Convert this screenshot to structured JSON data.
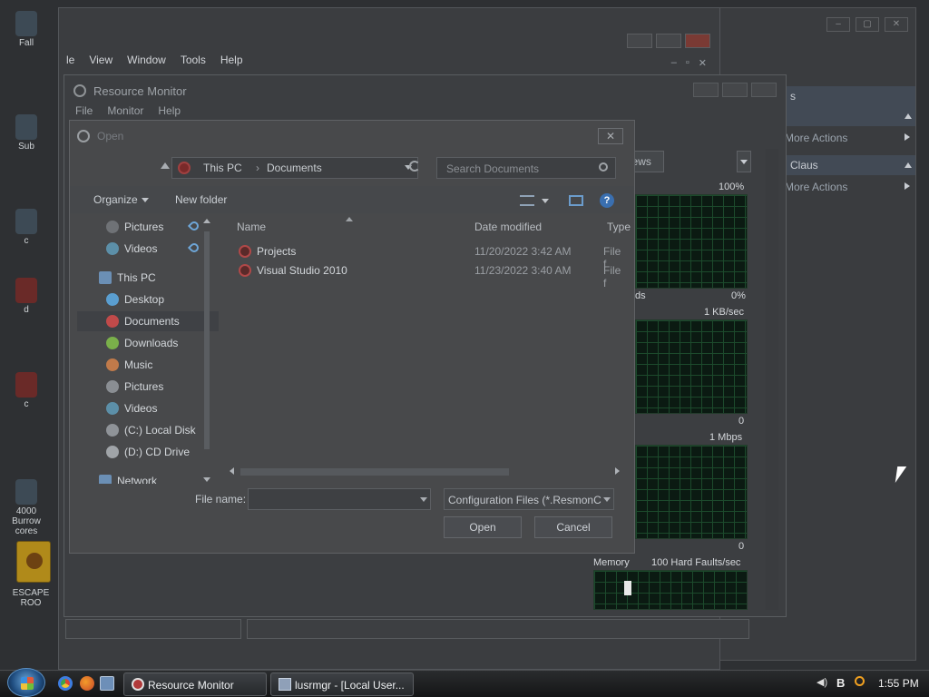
{
  "desktop": {
    "icons": [
      {
        "label": "Fall"
      },
      {
        "label": "Sub"
      },
      {
        "label": "c"
      },
      {
        "label": "d"
      },
      {
        "label": "c"
      },
      {
        "label": "4000 Burrow cores"
      },
      {
        "label": "ESCAPE ROO"
      }
    ]
  },
  "bg_window": {
    "menu": [
      "le",
      "View",
      "Window",
      "Tools",
      "Help"
    ]
  },
  "right_pane": {
    "sections": [
      {
        "header": "s",
        "item": "More Actions"
      },
      {
        "header": "Claus",
        "item": "More Actions"
      }
    ]
  },
  "resource_monitor": {
    "title": "Resource Monitor",
    "menu": [
      "File",
      "Monitor",
      "Help"
    ],
    "views_label": "Views",
    "graphs": [
      {
        "top_label": "100%",
        "bottom_left": "ds",
        "bottom_right": "0%"
      },
      {
        "top_label": "1 KB/sec",
        "bottom_left": "",
        "bottom_right": "0"
      },
      {
        "top_label": "1 Mbps",
        "bottom_left": "",
        "bottom_right": "0"
      },
      {
        "top_left": "Memory",
        "top_label": "100 Hard Faults/sec"
      }
    ]
  },
  "open_dialog": {
    "title": "Open",
    "breadcrumb": [
      "This PC",
      "Documents"
    ],
    "search_placeholder": "Search Documents",
    "toolbar": {
      "organize": "Organize",
      "new_folder": "New folder"
    },
    "nav": [
      {
        "label": "Pictures",
        "pinned": true,
        "icon_color": "#7d8288"
      },
      {
        "label": "Videos",
        "pinned": true,
        "icon_color": "#5c8fa8"
      },
      {
        "label": "This PC",
        "icon_color": "#6b8fb5"
      },
      {
        "label": "Desktop",
        "icon_color": "#5a9ed0"
      },
      {
        "label": "Documents",
        "selected": true,
        "icon_color": "#c04a4a"
      },
      {
        "label": "Downloads",
        "icon_color": "#7ab04a"
      },
      {
        "label": "Music",
        "icon_color": "#c07a4a"
      },
      {
        "label": "Pictures",
        "icon_color": "#8a8e93"
      },
      {
        "label": "Videos",
        "icon_color": "#5c8fa8"
      },
      {
        "label": "(C:) Local Disk",
        "icon_color": "#8f9398"
      },
      {
        "label": "(D:) CD Drive",
        "icon_color": "#a0a4a8"
      },
      {
        "label": "Network",
        "icon_color": "#6b8fb5"
      }
    ],
    "columns": {
      "name": "Name",
      "date": "Date modified",
      "type": "Type"
    },
    "files": [
      {
        "name": "Projects",
        "date": "11/20/2022 3:42 AM",
        "type": "File f"
      },
      {
        "name": "Visual Studio 2010",
        "date": "11/23/2022 3:40 AM",
        "type": "File f"
      }
    ],
    "file_name_label": "File name:",
    "file_name_value": "",
    "file_type": "Configuration Files (*.ResmonC",
    "open_label": "Open",
    "cancel_label": "Cancel",
    "close_glyph": "✕"
  },
  "taskbar": {
    "tasks": [
      {
        "label": "Resource Monitor"
      },
      {
        "label": "lusrmgr - [Local User..."
      }
    ],
    "clock": "1:55 PM"
  }
}
